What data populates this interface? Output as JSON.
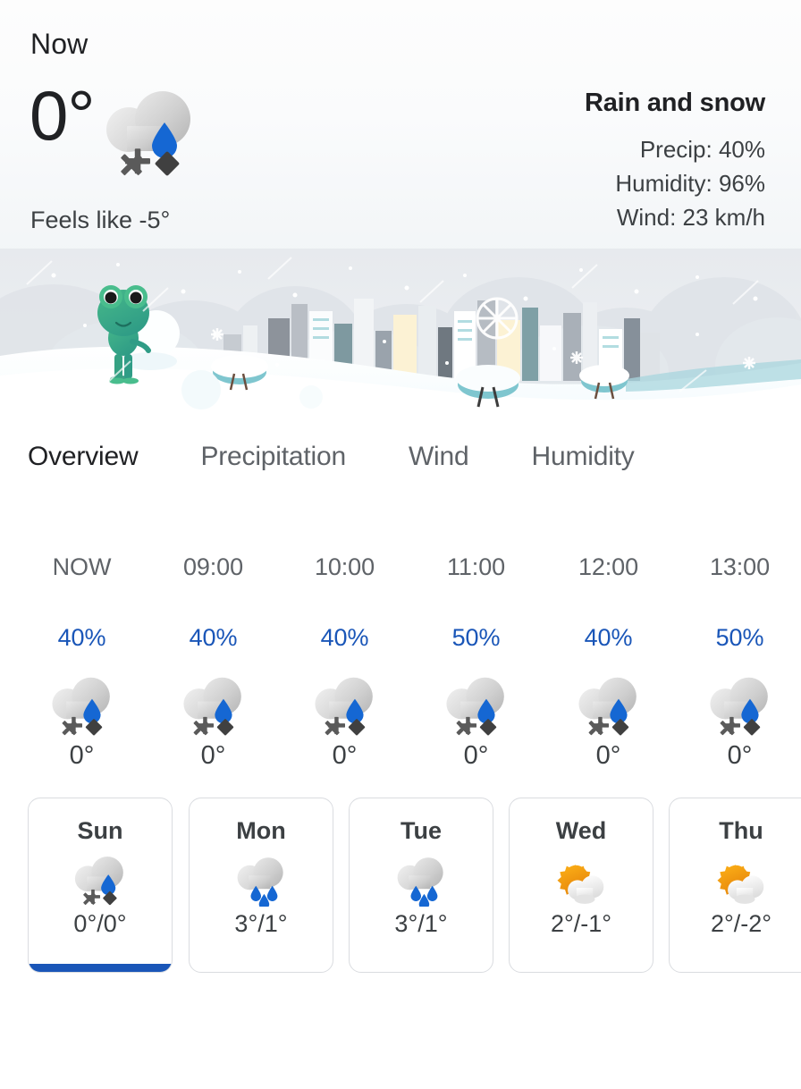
{
  "header": {
    "now_label": "Now",
    "temperature": "0°",
    "feels_like": "Feels like -5°",
    "condition": "Rain and snow",
    "precip": "Precip: 40%",
    "humidity": "Humidity: 96%",
    "wind": "Wind: 23 km/h",
    "icon": "sleet-icon"
  },
  "scene": {
    "name": "snowy-city-frog-illustration"
  },
  "tabs": {
    "items": [
      {
        "label": "Overview",
        "active": true
      },
      {
        "label": "Precipitation",
        "active": false
      },
      {
        "label": "Wind",
        "active": false
      },
      {
        "label": "Humidity",
        "active": false
      }
    ]
  },
  "hourly": [
    {
      "time": "NOW",
      "precip": "40%",
      "temp": "0°",
      "icon": "sleet-icon"
    },
    {
      "time": "09:00",
      "precip": "40%",
      "temp": "0°",
      "icon": "sleet-icon"
    },
    {
      "time": "10:00",
      "precip": "40%",
      "temp": "0°",
      "icon": "sleet-icon"
    },
    {
      "time": "11:00",
      "precip": "50%",
      "temp": "0°",
      "icon": "sleet-icon"
    },
    {
      "time": "12:00",
      "precip": "40%",
      "temp": "0°",
      "icon": "sleet-icon"
    },
    {
      "time": "13:00",
      "precip": "50%",
      "temp": "0°",
      "icon": "sleet-icon"
    }
  ],
  "daily": [
    {
      "day": "Sun",
      "temps": "0°/0°",
      "icon": "sleet-icon",
      "selected": true
    },
    {
      "day": "Mon",
      "temps": "3°/1°",
      "icon": "rain-icon",
      "selected": false
    },
    {
      "day": "Tue",
      "temps": "3°/1°",
      "icon": "rain-icon",
      "selected": false
    },
    {
      "day": "Wed",
      "temps": "2°/-1°",
      "icon": "sun-cloud-icon",
      "selected": false
    },
    {
      "day": "Thu",
      "temps": "2°/-2°",
      "icon": "sun-cloud-icon",
      "selected": false
    }
  ],
  "colors": {
    "accent_blue": "#1a56b8",
    "drop_blue": "#1567d3",
    "sun_orange": "#f0900f",
    "text_primary": "#202124",
    "text_secondary": "#5f6368",
    "card_border": "#dadce0"
  }
}
